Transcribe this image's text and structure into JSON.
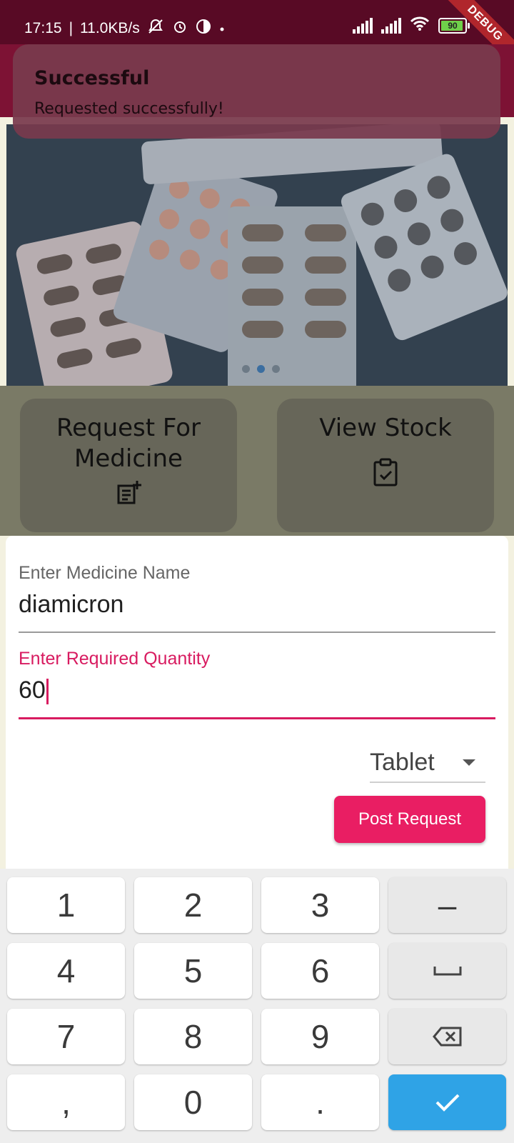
{
  "status_bar": {
    "time": "17:15",
    "speed": "11.0KB/s",
    "battery_level": "90",
    "debug_banner": "DEBUG"
  },
  "snackbar": {
    "title": "Successful",
    "message": "Requested successfully!"
  },
  "carousel": {
    "slide_count": 3,
    "active_index": 1
  },
  "actions": {
    "request_label": "Request For Medicine",
    "stock_label": "View Stock"
  },
  "form": {
    "medicine_label": "Enter Medicine Name",
    "medicine_value": "diamicron",
    "quantity_label": "Enter Required Quantity",
    "quantity_value": "60",
    "unit_selected": "Tablet",
    "post_button": "Post Request"
  },
  "keyboard": {
    "row1": [
      "1",
      "2",
      "3",
      "–"
    ],
    "row2": [
      "4",
      "5",
      "6"
    ],
    "row3": [
      "7",
      "8",
      "9"
    ],
    "row4": [
      ",",
      "0",
      "."
    ]
  },
  "colors": {
    "primary": "#e91e63",
    "app_bar": "#7d1234",
    "confirm_key": "#2fa3e6"
  }
}
